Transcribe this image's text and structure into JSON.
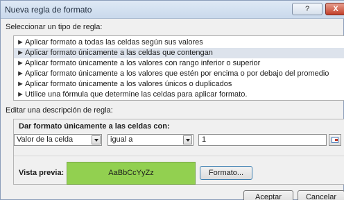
{
  "window": {
    "title": "Nueva regla de formato",
    "help_label": "?",
    "close_label": "X"
  },
  "rule_type": {
    "label": "Seleccionar un tipo de regla:",
    "items": [
      {
        "label": "Aplicar formato a todas las celdas según sus valores",
        "selected": false
      },
      {
        "label": "Aplicar formato únicamente a las celdas que contengan",
        "selected": true
      },
      {
        "label": "Aplicar formato únicamente a los valores con rango inferior o superior",
        "selected": false
      },
      {
        "label": "Aplicar formato únicamente a los valores que estén por encima o por debajo del promedio",
        "selected": false
      },
      {
        "label": "Aplicar formato únicamente a los valores únicos o duplicados",
        "selected": false
      },
      {
        "label": "Utilice una fórmula que determine las celdas para aplicar formato.",
        "selected": false
      }
    ],
    "arrow": "►"
  },
  "rule_desc": {
    "label": "Editar una descripción de regla:",
    "title": "Dar formato únicamente a las celdas con:",
    "condition_select": "Valor de la celda",
    "operator_select": "igual a",
    "value_input": "1"
  },
  "preview": {
    "label": "Vista previa:",
    "sample_text": "AaBbCcYyZz",
    "color": "#92d050",
    "format_button": "Formato..."
  },
  "footer": {
    "ok_label": "Aceptar",
    "cancel_label": "Cancelar"
  }
}
